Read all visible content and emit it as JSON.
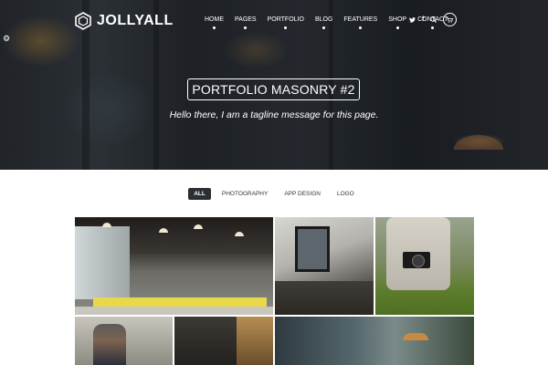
{
  "brand": {
    "name": "JOLLYALL"
  },
  "nav": {
    "items": [
      "HOME",
      "PAGES",
      "PORTFOLIO",
      "BLOG",
      "FEATURES",
      "SHOP",
      "CONTACT"
    ]
  },
  "icons": {
    "twitter": "twitter-icon",
    "facebook": "facebook-icon",
    "search": "search-icon",
    "cart": "cart-icon",
    "menu": "hamburger-menu-icon",
    "settings": "gear-icon"
  },
  "hero": {
    "title": "PORTFOLIO MASONRY #2",
    "tagline": "Hello there, I am a tagline message for this page."
  },
  "filters": {
    "items": [
      "ALL",
      "PHOTOGRAPHY",
      "APP DESIGN",
      "LOGO"
    ],
    "active": "ALL"
  },
  "colors": {
    "filter_active_bg": "#2b2f33",
    "hero_text": "#ffffff"
  }
}
